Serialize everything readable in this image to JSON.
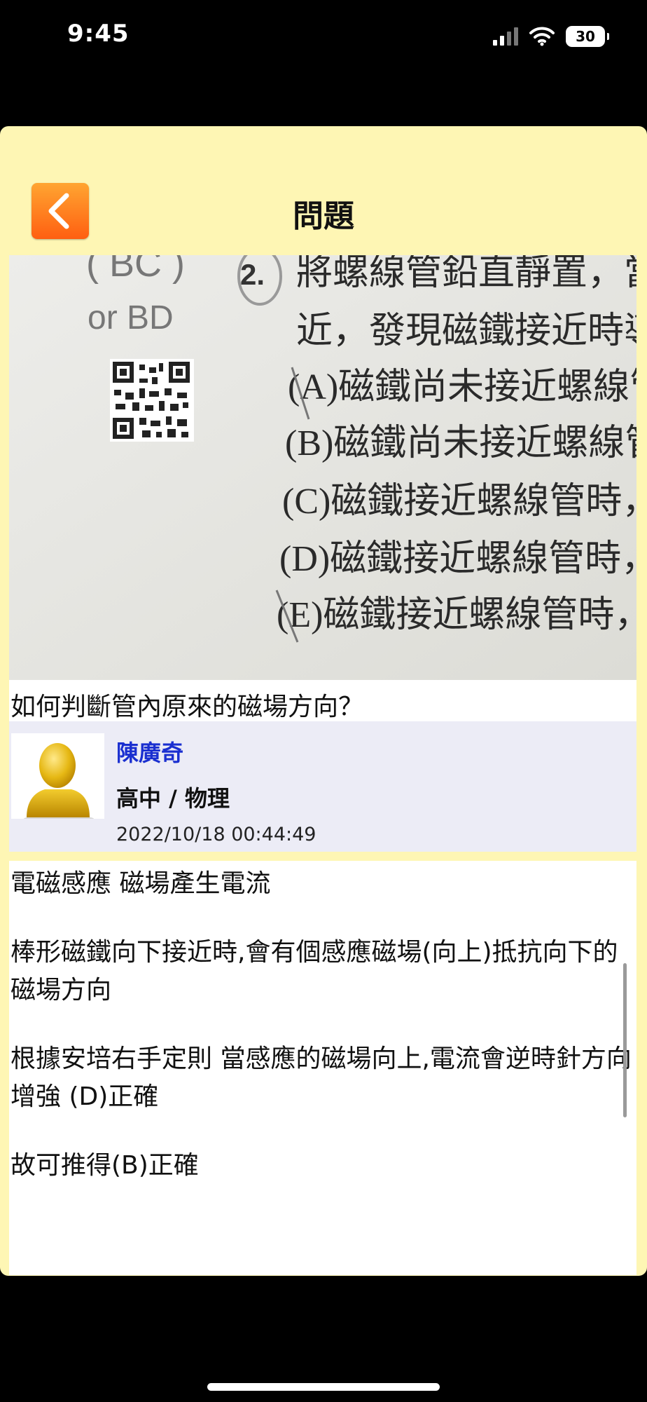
{
  "status_bar": {
    "time": "9:45",
    "battery": "30"
  },
  "nav": {
    "title": "問題",
    "back_icon": "chevron-left-icon"
  },
  "question": {
    "photo_text": {
      "answer_mark": "( BC )",
      "alt_answer": "or BD",
      "number": "2.",
      "lines": [
        "將螺線管鉛直靜置，當",
        "近，發現磁鐵接近時導",
        "(A)磁鐵尚未接近螺線管",
        "(B)磁鐵尚未接近螺線管",
        "(C)磁鐵接近螺線管時，",
        "(D)磁鐵接近螺線管時，",
        "(E)磁鐵接近螺線管時，"
      ]
    },
    "text": "如何判斷管內原來的磁場方向？"
  },
  "answer": {
    "name": "陳廣奇",
    "subject": "高中 / 物理",
    "timestamp": "2022/10/18 00:44:49",
    "paragraphs": [
      "電磁感應 磁場產生電流",
      "棒形磁鐵向下接近時,會有個感應磁場(向上)抵抗向下的磁場方向",
      "根據安培右手定則 當感應的磁場向上,電流會逆時針方向增強 (D)正確",
      "故可推得(B)正確"
    ]
  },
  "colors": {
    "frame": "#fef6b4",
    "answer_header": "#ececf6",
    "name": "#1a2fd0",
    "back_button": "#ff7a1f"
  }
}
